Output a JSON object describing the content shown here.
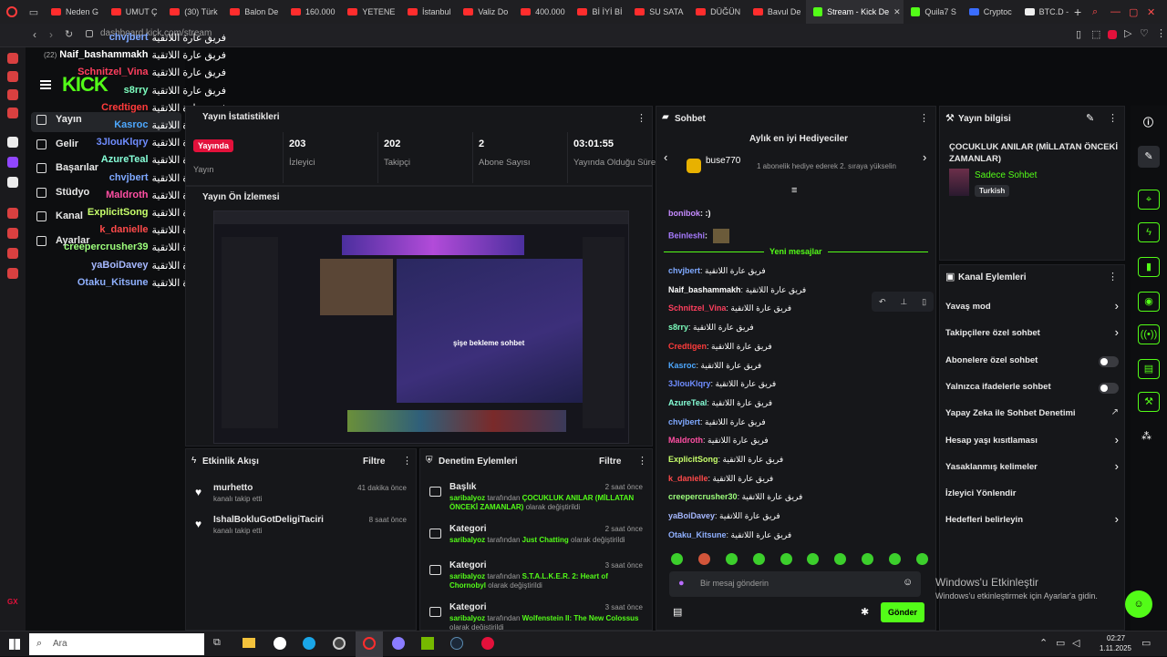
{
  "browser": {
    "tabs": [
      {
        "label": "Neden G",
        "icon": "youtube-icon"
      },
      {
        "label": "UMUT Ç",
        "icon": "youtube-icon"
      },
      {
        "label": "(30) Türk",
        "icon": "youtube-icon"
      },
      {
        "label": "Balon De",
        "icon": "youtube-icon"
      },
      {
        "label": "160.000",
        "icon": "youtube-icon"
      },
      {
        "label": "YETENE",
        "icon": "youtube-icon"
      },
      {
        "label": "İstanbul",
        "icon": "youtube-icon"
      },
      {
        "label": "Valiz Do",
        "icon": "youtube-icon"
      },
      {
        "label": "400.000",
        "icon": "youtube-icon"
      },
      {
        "label": "Bİ İYİ Bİ",
        "icon": "youtube-icon"
      },
      {
        "label": "SU SATA",
        "icon": "youtube-icon"
      },
      {
        "label": "DÜĞÜN",
        "icon": "youtube-icon"
      },
      {
        "label": "Bavul De",
        "icon": "youtube-icon"
      },
      {
        "label": "Stream - Kick De",
        "icon": "kick-icon",
        "active": true
      },
      {
        "label": "Quila7 S",
        "icon": "kick-icon"
      },
      {
        "label": "Cryptoc",
        "icon": "shield-icon"
      },
      {
        "label": "BTC.D -",
        "icon": "tv-icon"
      }
    ],
    "url": "dashboard.kick.com/stream"
  },
  "kick": {
    "logo": "KICK",
    "nav": [
      "Yayın",
      "Gelir",
      "Başarılar",
      "Stüdyo",
      "Kanal",
      "Ayarlar"
    ],
    "notification_count": "(22)"
  },
  "overlay_chat": {
    "message": "فريق عارة اللاتقية",
    "users": [
      {
        "name": "chvjbert",
        "color": "#7ea8ff"
      },
      {
        "name": "Naif_bashammakh",
        "color": "#ffffff"
      },
      {
        "name": "Schnitzel_Vina",
        "color": "#ff3f5e"
      },
      {
        "name": "s8rry",
        "color": "#7dffbf"
      },
      {
        "name": "Credtigen",
        "color": "#ff3b3b"
      },
      {
        "name": "Kasroc",
        "color": "#4da8ff"
      },
      {
        "name": "3JlouKlqry",
        "color": "#6f8dff"
      },
      {
        "name": "AzureTeal",
        "color": "#86ffd7"
      },
      {
        "name": "chvjbert",
        "color": "#7ea8ff"
      },
      {
        "name": "Maldroth",
        "color": "#ff4fa3"
      },
      {
        "name": "ExplicitSong",
        "color": "#c7ff6b"
      },
      {
        "name": "k_danielle",
        "color": "#ff4a4a"
      },
      {
        "name": "creepercrusher39",
        "color": "#9dff7c"
      },
      {
        "name": "yaBoiDavey",
        "color": "#a6b8ff"
      },
      {
        "name": "Otaku_Kitsune",
        "color": "#8fb0ff"
      }
    ]
  },
  "stats": {
    "title": "Yayın İstatistikleri",
    "live_badge": "Yayında",
    "live_label": "Yayın",
    "items": [
      {
        "value": "203",
        "label": "İzleyici"
      },
      {
        "value": "202",
        "label": "Takipçi"
      },
      {
        "value": "2",
        "label": "Abone Sayısı"
      },
      {
        "value": "03:01:55",
        "label": "Yayında Olduğu Süre"
      }
    ],
    "preview_title": "Yayın Ön İzlemesi",
    "preview_inner_text": "şişe bekleme sohbet"
  },
  "activity": {
    "title": "Etkinlik Akışı",
    "filter": "Filtre",
    "items": [
      {
        "user": "murhetto",
        "text": "kanalı takip etti",
        "time": "41 dakika önce"
      },
      {
        "user": "IshalBokluGotDeligiTaciri",
        "text": "kanalı takip etti",
        "time": "8 saat önce"
      }
    ]
  },
  "moderation": {
    "title": "Denetim Eylemleri",
    "filter": "Filtre",
    "items": [
      {
        "type": "Başlık",
        "time": "2 saat önce",
        "actor": "saribalyoz",
        "mid": "tarafından",
        "value": "ÇOCUKLUK ANILAR (MİLLATAN ÖNCEKİ ZAMANLAR)",
        "tail": "olarak değiştirildi"
      },
      {
        "type": "Kategori",
        "time": "2 saat önce",
        "actor": "saribalyoz",
        "mid": "tarafından",
        "value": "Just Chatting",
        "tail": "olarak değiştirildi"
      },
      {
        "type": "Kategori",
        "time": "3 saat önce",
        "actor": "saribalyoz",
        "mid": "tarafından",
        "value": "S.T.A.L.K.E.R. 2: Heart of Chornobyl",
        "tail": "olarak değiştirildi"
      },
      {
        "type": "Kategori",
        "time": "3 saat önce",
        "actor": "saribalyoz",
        "mid": "tarafından",
        "value": "Wolfenstein II: The New Colossus",
        "tail": "olarak değiştirildi"
      }
    ]
  },
  "chat": {
    "title": "Sohbet",
    "top_gifters_title": "Aylık en iyi Hediyeciler",
    "top_gifter": "buse770",
    "top_gifter_note": "1 abonelik hediye ederek 2. sıraya yükselin",
    "old_messages": [
      {
        "user": "bonibok",
        "text": ":)",
        "color": "#c58bff"
      },
      {
        "user": "Beinleshi",
        "text": "",
        "color": "#a77bff"
      }
    ],
    "new_messages_label": "Yeni mesajlar",
    "message_text": "فريق عارة اللاتقية",
    "messages": [
      {
        "user": "chvjbert",
        "color": "#7ea8ff"
      },
      {
        "user": "Naif_bashammakh",
        "color": "#ffffff"
      },
      {
        "user": "Schnitzel_Vina",
        "color": "#ff3f5e"
      },
      {
        "user": "s8rry",
        "color": "#7dffbf"
      },
      {
        "user": "Credtigen",
        "color": "#ff3b3b"
      },
      {
        "user": "Kasroc",
        "color": "#4da8ff"
      },
      {
        "user": "3JlouKlqry",
        "color": "#6f8dff"
      },
      {
        "user": "AzureTeal",
        "color": "#86ffd7"
      },
      {
        "user": "chvjbert",
        "color": "#7ea8ff"
      },
      {
        "user": "Maldroth",
        "color": "#ff4fa3"
      },
      {
        "user": "ExplicitSong",
        "color": "#c7ff6b"
      },
      {
        "user": "k_danielle",
        "color": "#ff4a4a"
      },
      {
        "user": "creepercrusher30",
        "color": "#9dff7c"
      },
      {
        "user": "yaBoiDavey",
        "color": "#a6b8ff"
      },
      {
        "user": "Otaku_Kitsune",
        "color": "#8fb0ff"
      }
    ],
    "input_placeholder": "Bir mesaj gönderin",
    "send_label": "Gönder"
  },
  "stream_info": {
    "title": "Yayın bilgisi",
    "stream_title": "ÇOCUKLUK ANILAR (MİLLATAN ÖNCEKİ ZAMANLAR)",
    "category": "Sadece Sohbet",
    "tag": "Turkish"
  },
  "channel_actions": {
    "title": "Kanal Eylemleri",
    "items": [
      {
        "label": "Yavaş mod",
        "control": "chevron"
      },
      {
        "label": "Takipçilere özel sohbet",
        "control": "chevron"
      },
      {
        "label": "Abonelere özel sohbet",
        "control": "toggle"
      },
      {
        "label": "Yalnızca ifadelerle sohbet",
        "control": "toggle"
      },
      {
        "label": "Yapay Zeka ile Sohbet Denetimi",
        "control": "external"
      },
      {
        "label": "Hesap yaşı kısıtlaması",
        "control": "chevron"
      },
      {
        "label": "Yasaklanmış kelimeler",
        "control": "chevron"
      },
      {
        "label": "İzleyici Yönlendir",
        "control": "none"
      },
      {
        "label": "Hedefleri belirleyin",
        "control": "chevron"
      }
    ]
  },
  "watermark": {
    "line1": "Windows'u Etkinleştir",
    "line2": "Windows'u etkinleştirmek için Ayarlar'a gidin."
  },
  "taskbar": {
    "search_placeholder": "Ara",
    "time": "02:27",
    "date": "1.11.2025"
  },
  "colors": {
    "kick_green": "#53fc18",
    "accent_red": "#e3113b"
  }
}
